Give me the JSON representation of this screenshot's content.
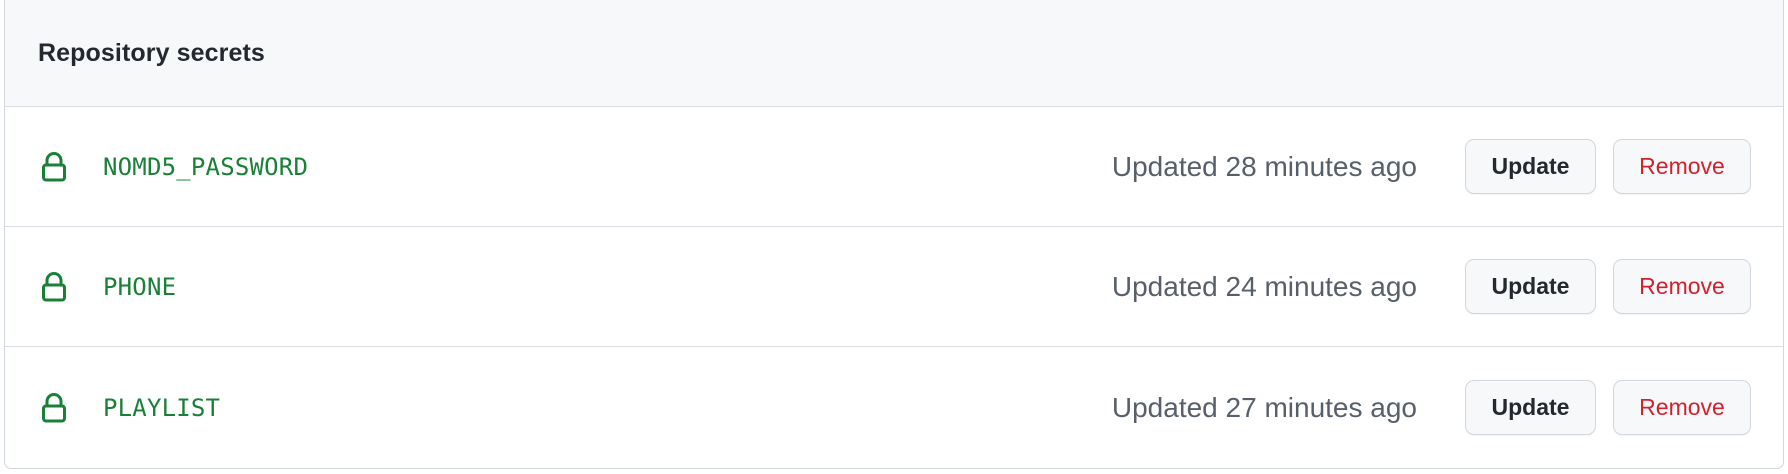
{
  "panel": {
    "title": "Repository secrets"
  },
  "secrets": [
    {
      "name": "NOMD5_PASSWORD",
      "updated": "Updated 28 minutes ago",
      "update_label": "Update",
      "remove_label": "Remove"
    },
    {
      "name": "PHONE",
      "updated": "Updated 24 minutes ago",
      "update_label": "Update",
      "remove_label": "Remove"
    },
    {
      "name": "PLAYLIST",
      "updated": "Updated 27 minutes ago",
      "update_label": "Update",
      "remove_label": "Remove"
    }
  ],
  "icons": {
    "secret": "lock-icon"
  },
  "colors": {
    "secret_name": "#1a7f37",
    "lock_icon": "#1a7f37",
    "remove_text": "#cf222e",
    "header_bg": "#f6f8fa",
    "border": "#d0d7de"
  }
}
